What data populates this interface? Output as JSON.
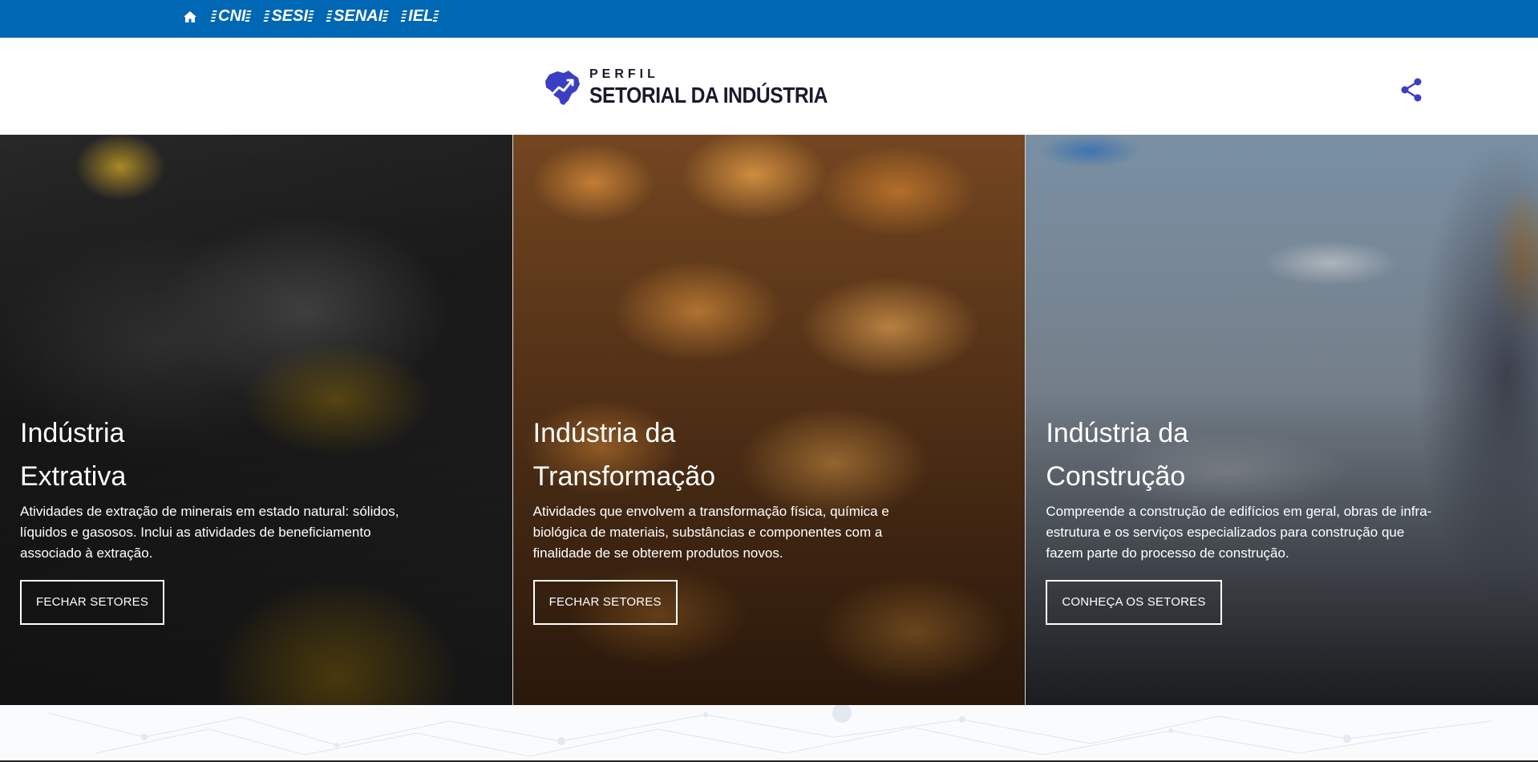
{
  "topbar": {
    "brands": [
      "CNI",
      "SESI",
      "SENAI",
      "IEL"
    ]
  },
  "header": {
    "logo_top": "PERFIL",
    "logo_bottom": "SETORIAL DA INDÚSTRIA"
  },
  "panels": [
    {
      "title": "Indústria\nExtrativa",
      "description": "Atividades de extração de minerais em estado natural: sólidos, líquidos e gasosos. Inclui as atividades de beneficiamento associado à extração.",
      "button": "FECHAR SETORES"
    },
    {
      "title": "Indústria da\nTransformação",
      "description": "Atividades que envolvem a transformação física, química e biológica de materiais, substâncias e componentes com a finalidade de se obterem produtos novos.",
      "button": "FECHAR SETORES"
    },
    {
      "title": "Indústria da\nConstrução",
      "description": "Compreende a construção de edifícios em geral, obras de infra-estrutura e os serviços especializados para construção que fazem parte do processo de construção.",
      "button": "CONHEÇA OS SETORES"
    }
  ],
  "colors": {
    "topbar": "#0067b5",
    "logo_accent": "#3b3fc4",
    "share_icon": "#3b3fc4"
  },
  "icons": {
    "home": "home-icon",
    "share": "share-icon",
    "logo": "brazil-map-icon"
  }
}
